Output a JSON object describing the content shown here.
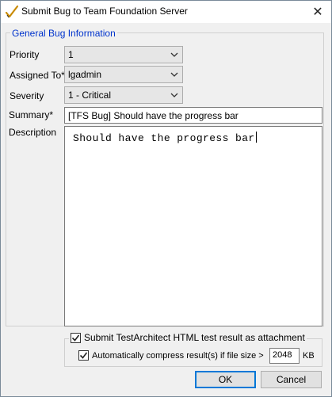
{
  "window": {
    "title": "Submit Bug to Team Foundation Server",
    "icon": "checkmark-pen-icon",
    "close_glyph": "✕"
  },
  "group": {
    "legend": "General Bug Information"
  },
  "fields": {
    "priority": {
      "label": "Priority",
      "value": "1"
    },
    "assigned_to": {
      "label": "Assigned To*",
      "value": "lgadmin"
    },
    "severity": {
      "label": "Severity",
      "value": "1 - Critical"
    },
    "summary": {
      "label": "Summary*",
      "value": "[TFS Bug] Should have the progress bar"
    },
    "description": {
      "label": "Description",
      "value": "Should have the progress bar"
    }
  },
  "attachment": {
    "submit_label": "Submit TestArchitect HTML test result as attachment",
    "submit_checked": true,
    "compress_label": "Automatically compress result(s) if file size >",
    "compress_checked": true,
    "size_value": "2048",
    "size_unit": "KB"
  },
  "buttons": {
    "ok": "OK",
    "cancel": "Cancel"
  },
  "colors": {
    "legend": "#0033cc",
    "default_button_border": "#0078d7"
  }
}
